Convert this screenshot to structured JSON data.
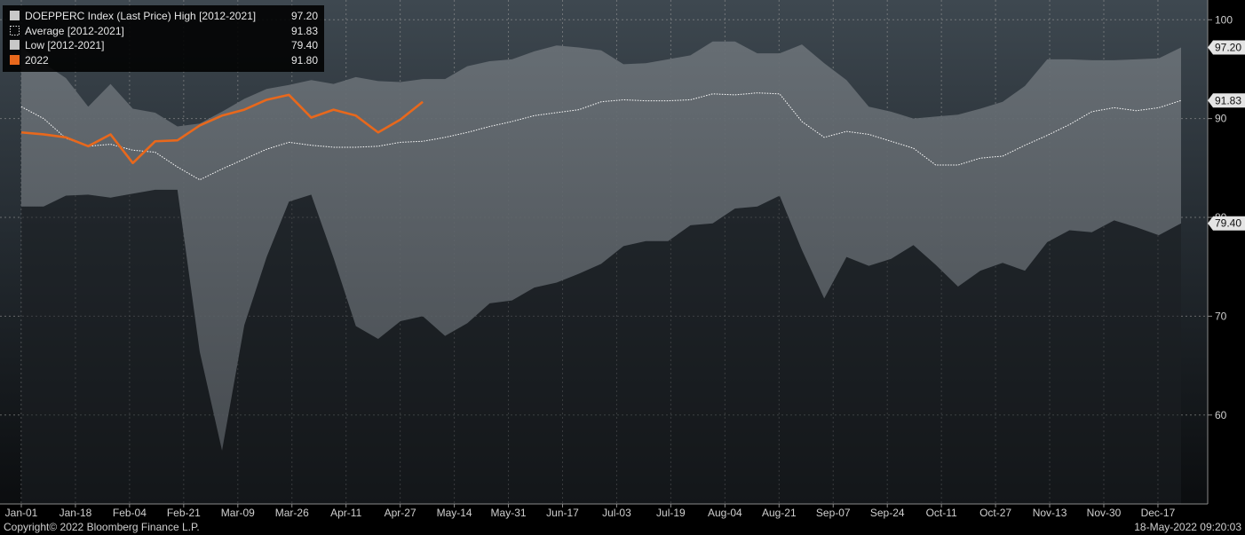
{
  "chart_data": {
    "type": "area",
    "title": "",
    "xlabel": "",
    "ylabel": "",
    "ylim": [
      51,
      102
    ],
    "yticks": [
      60,
      70,
      80,
      90,
      100
    ],
    "grid": true,
    "legend_position": "top-left",
    "x_ticks": [
      "Jan-01",
      "Jan-18",
      "Feb-04",
      "Feb-21",
      "Mar-09",
      "Mar-26",
      "Apr-11",
      "Apr-27",
      "May-14",
      "May-31",
      "Jun-17",
      "Jul-03",
      "Jul-19",
      "Aug-04",
      "Aug-21",
      "Sep-07",
      "Sep-24",
      "Oct-11",
      "Oct-27",
      "Nov-13",
      "Nov-30",
      "Dec-17"
    ],
    "x": [
      "Jan-01",
      "Jan-08",
      "Jan-15",
      "Jan-22",
      "Jan-29",
      "Feb-05",
      "Feb-12",
      "Feb-19",
      "Feb-26",
      "Mar-05",
      "Mar-12",
      "Mar-19",
      "Mar-26",
      "Apr-02",
      "Apr-09",
      "Apr-16",
      "Apr-23",
      "Apr-30",
      "May-07",
      "May-14",
      "May-21",
      "May-28",
      "Jun-04",
      "Jun-11",
      "Jun-18",
      "Jun-25",
      "Jul-02",
      "Jul-09",
      "Jul-16",
      "Jul-23",
      "Jul-30",
      "Aug-06",
      "Aug-13",
      "Aug-20",
      "Aug-27",
      "Sep-03",
      "Sep-10",
      "Sep-17",
      "Sep-24",
      "Oct-01",
      "Oct-08",
      "Oct-15",
      "Oct-22",
      "Oct-29",
      "Nov-05",
      "Nov-12",
      "Nov-19",
      "Nov-26",
      "Dec-03",
      "Dec-10",
      "Dec-17",
      "Dec-24",
      "Dec-31"
    ],
    "series": [
      {
        "name": "High [2012-2021]",
        "color": "#9a9a9a",
        "values": [
          97.2,
          95.6,
          94.1,
          91.2,
          93.5,
          91.0,
          90.6,
          89.2,
          89.5,
          90.7,
          92.0,
          93.0,
          93.4,
          93.9,
          93.5,
          94.2,
          93.8,
          93.7,
          94.0,
          94.0,
          95.3,
          95.8,
          96.0,
          96.8,
          97.4,
          97.2,
          96.9,
          95.5,
          95.6,
          96.0,
          96.4,
          97.8,
          97.8,
          96.6,
          96.6,
          97.5,
          95.6,
          93.9,
          91.2,
          90.7,
          90.0,
          90.2,
          90.4,
          91.0,
          91.7,
          93.3,
          96.0,
          96.0,
          95.9,
          95.9,
          96.0,
          96.1,
          97.2
        ]
      },
      {
        "name": "Average [2012-2021]",
        "color": "#ffffff",
        "values": [
          91.2,
          90.0,
          88.0,
          87.2,
          87.4,
          86.8,
          86.6,
          85.1,
          83.8,
          84.9,
          85.9,
          86.9,
          87.6,
          87.3,
          87.1,
          87.1,
          87.2,
          87.6,
          87.7,
          88.1,
          88.6,
          89.2,
          89.7,
          90.3,
          90.6,
          90.9,
          91.7,
          91.9,
          91.8,
          91.8,
          91.9,
          92.5,
          92.4,
          92.6,
          92.5,
          89.7,
          88.1,
          88.7,
          88.4,
          87.7,
          87.0,
          85.3,
          85.3,
          86.0,
          86.2,
          87.3,
          88.3,
          89.4,
          90.7,
          91.1,
          90.8,
          91.1,
          91.83
        ]
      },
      {
        "name": "Low [2012-2021]",
        "color": "#2a2a2a",
        "values": [
          81.1,
          81.1,
          82.2,
          82.3,
          82.0,
          82.4,
          82.8,
          82.8,
          66.4,
          56.4,
          69.1,
          76.0,
          81.6,
          82.3,
          75.9,
          69.0,
          67.7,
          69.5,
          70.0,
          68.0,
          69.3,
          71.3,
          71.6,
          72.9,
          73.4,
          74.3,
          75.3,
          77.1,
          77.6,
          77.6,
          79.2,
          79.4,
          80.9,
          81.1,
          82.2,
          76.7,
          71.8,
          76.0,
          75.1,
          75.8,
          77.2,
          75.2,
          73.0,
          74.6,
          75.4,
          74.6,
          77.5,
          78.7,
          78.5,
          79.7,
          79.0,
          78.2,
          79.4
        ]
      },
      {
        "name": "2022",
        "color": "#e8681c",
        "values": [
          88.6,
          88.4,
          88.1,
          87.2,
          88.4,
          85.5,
          87.7,
          87.8,
          89.3,
          90.3,
          90.9,
          91.9,
          92.4,
          90.1,
          90.9,
          90.3,
          88.6,
          89.9,
          91.7
        ]
      }
    ],
    "legend": [
      {
        "key": "high",
        "text": "DOEPPERC Index (Last Price) High [2012-2021]",
        "value": "97.20",
        "swatch": "solid-light"
      },
      {
        "key": "avg",
        "text": "Average  [2012-2021]",
        "value": "91.83",
        "swatch": "dotted"
      },
      {
        "key": "low",
        "text": "Low  [2012-2021]",
        "value": "79.40",
        "swatch": "solid-light"
      },
      {
        "key": "y2022",
        "text": "2022",
        "value": "91.80",
        "swatch": "orange"
      }
    ],
    "badges": [
      {
        "value": 97.2,
        "text": "97.20"
      },
      {
        "value": 91.83,
        "text": "91.83"
      },
      {
        "value": 79.4,
        "text": "79.40"
      }
    ],
    "ytick_labels": [
      "60",
      "70",
      "80",
      "90",
      "100"
    ]
  },
  "footer": {
    "copyright": "Copyright© 2022 Bloomberg Finance L.P.",
    "timestamp": "18-May-2022 09:20:03"
  }
}
